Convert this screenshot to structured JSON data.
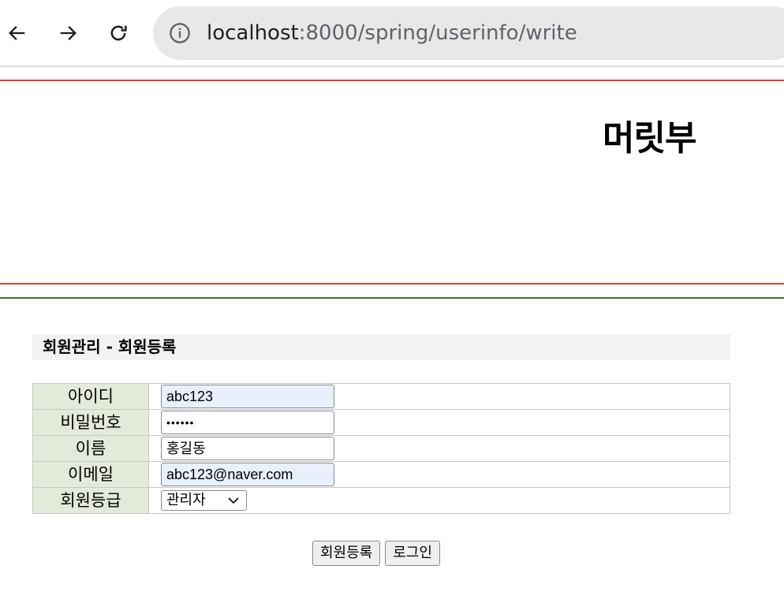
{
  "browser": {
    "url_host": "localhost",
    "url_rest": ":8000/spring/userinfo/write"
  },
  "header": {
    "site_title": "머릿부"
  },
  "form": {
    "section_title": "회원관리 - 회원등록",
    "fields": [
      {
        "label": "아이디",
        "value": "abc123"
      },
      {
        "label": "비밀번호",
        "value": "••••••"
      },
      {
        "label": "이름",
        "value": "홍길동"
      },
      {
        "label": "이메일",
        "value": "abc123@naver.com"
      },
      {
        "label": "회원등급",
        "value": "관리자"
      }
    ]
  },
  "buttons": {
    "register": "회원등록",
    "login": "로그인"
  }
}
